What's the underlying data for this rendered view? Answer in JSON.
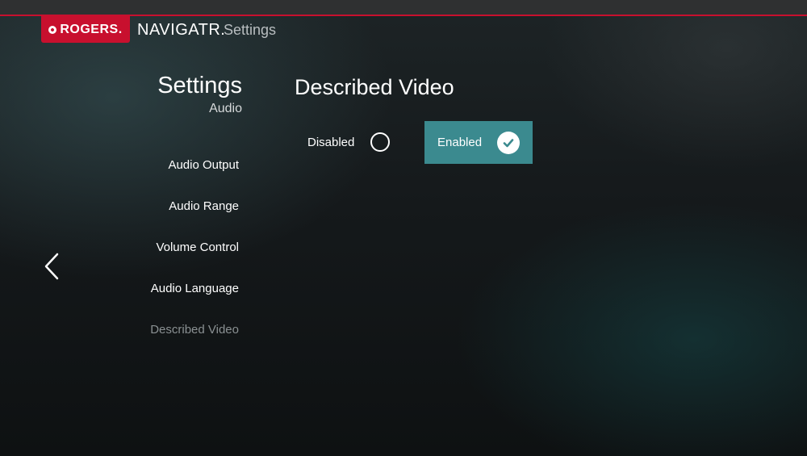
{
  "header": {
    "logo_text": "ROGERS.",
    "brand": "NAVIGATR.",
    "section": "Settings"
  },
  "nav": {
    "title": "Settings",
    "subtitle": "Audio",
    "items": [
      {
        "label": "Audio Output"
      },
      {
        "label": "Audio Range"
      },
      {
        "label": "Volume Control"
      },
      {
        "label": "Audio Language"
      },
      {
        "label": "Described Video",
        "active": true
      }
    ]
  },
  "panel": {
    "title": "Described Video",
    "options": [
      {
        "label": "Disabled",
        "selected": false
      },
      {
        "label": "Enabled",
        "selected": true
      }
    ]
  },
  "colors": {
    "brand_red": "#c8102e",
    "selected_teal": "#3b8a8f",
    "inactive_text": "#8a9092"
  },
  "icons": {
    "back": "chevron-left-icon",
    "unchecked": "radio-unchecked-icon",
    "checked": "check-circle-icon"
  }
}
